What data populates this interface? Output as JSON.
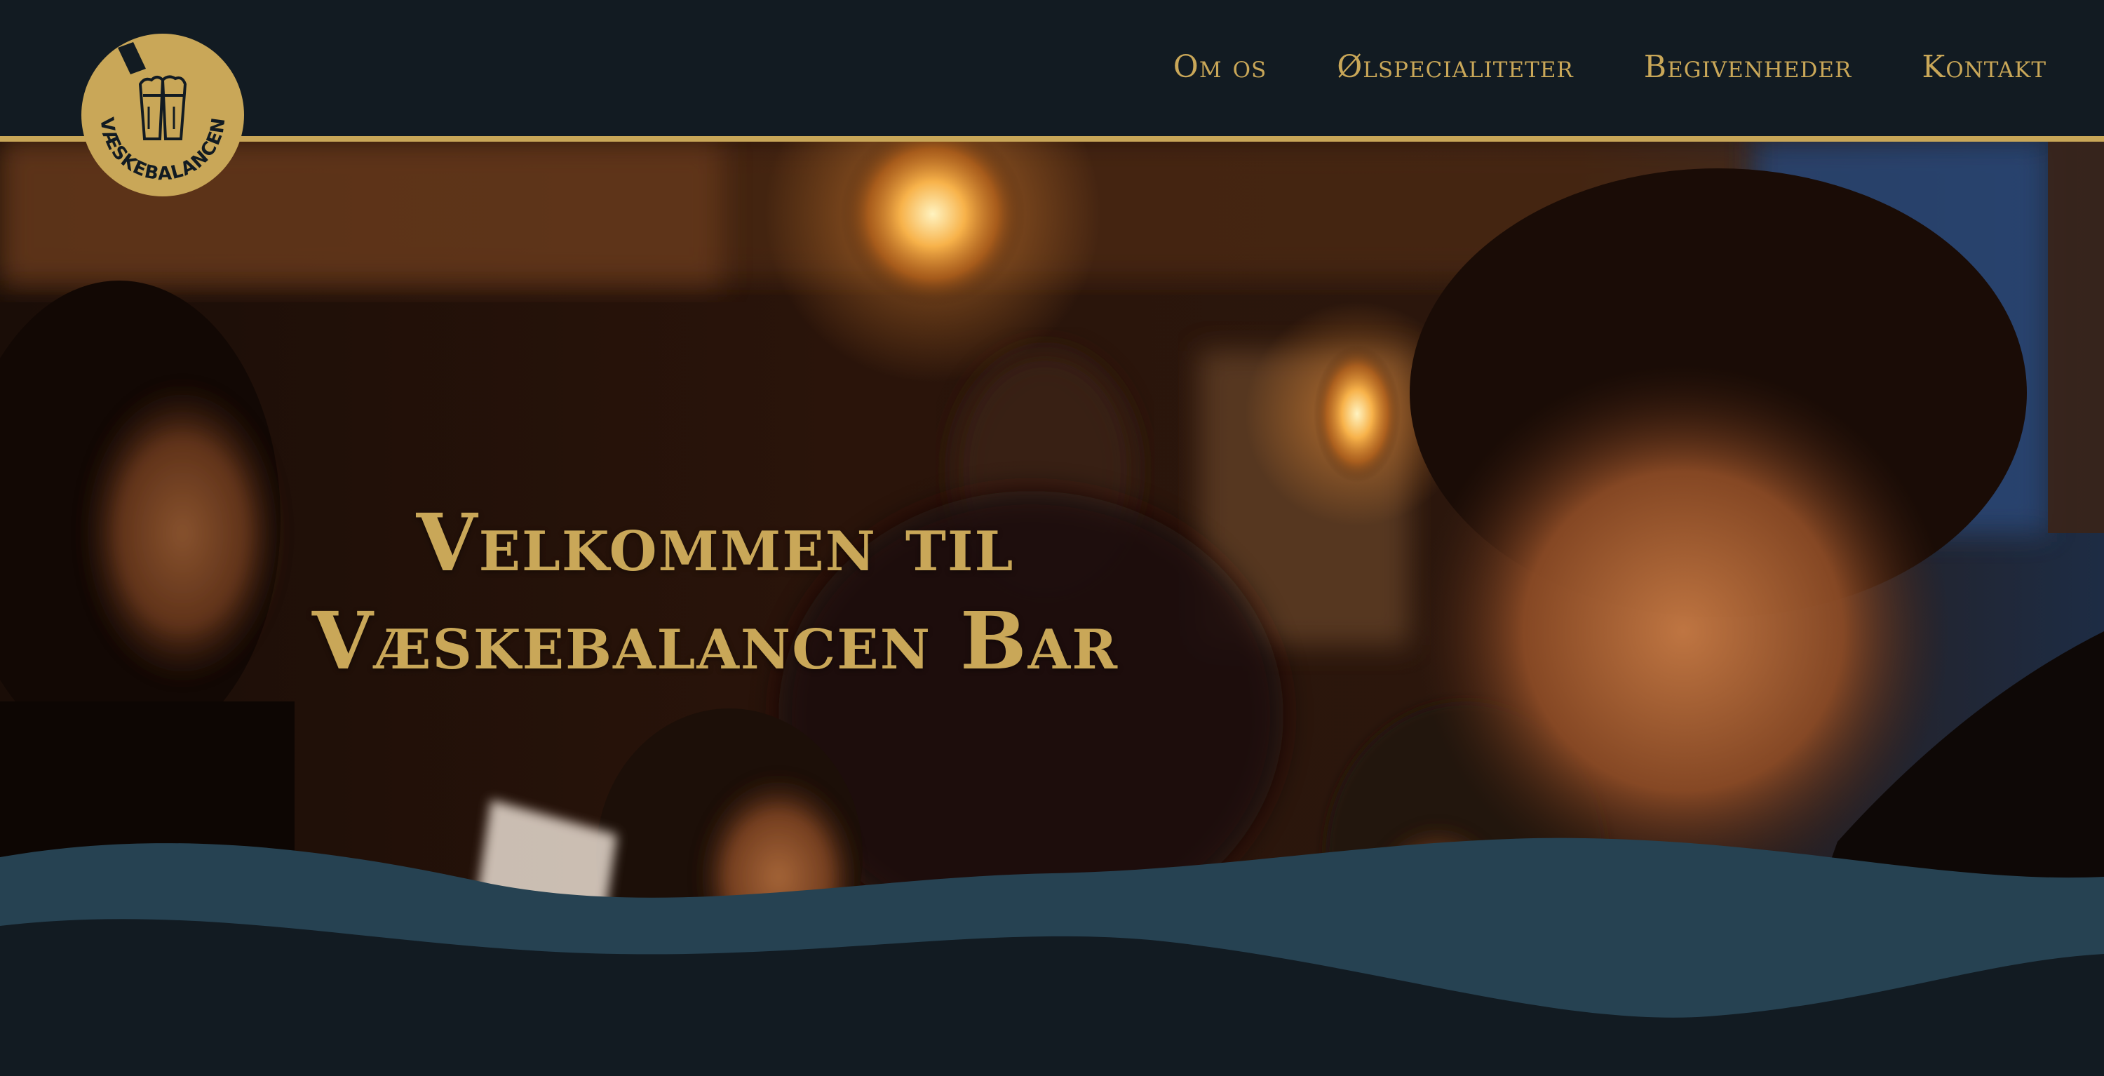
{
  "brand": {
    "logo_text": "VÆSKEBALANCEN",
    "logo_icon": "beer-glasses-icon"
  },
  "nav": {
    "items": [
      {
        "label": "Om os"
      },
      {
        "label": "Ølspecialiteter"
      },
      {
        "label": "Begivenheder"
      },
      {
        "label": "Kontakt"
      }
    ]
  },
  "hero": {
    "title_line1": "Velkommen til",
    "title_line2": "Væskebalancen Bar"
  },
  "colors": {
    "accent_gold": "#c9a758",
    "navy_dark": "#121b22",
    "wave_teal": "#264252"
  }
}
